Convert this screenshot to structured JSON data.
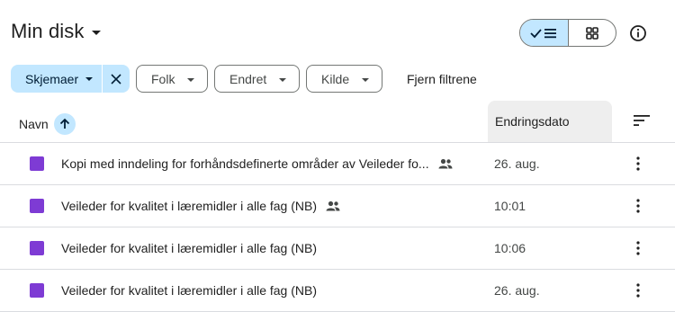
{
  "header": {
    "title": "Min disk"
  },
  "view_toggle": {
    "list_icon": "check-list-icon",
    "grid_icon": "grid-icon"
  },
  "filters": [
    {
      "label": "Skjemaer",
      "active": true
    },
    {
      "label": "Folk"
    },
    {
      "label": "Endret"
    },
    {
      "label": "Kilde"
    }
  ],
  "clear_filters_label": "Fjern filtrene",
  "columns": {
    "name": "Navn",
    "modified": "Endringsdato"
  },
  "files": [
    {
      "name": "Kopi med inndeling for forhåndsdefinerte områder av Veileder fo...",
      "date": "26. aug.",
      "shared": true
    },
    {
      "name": "Veileder for kvalitet i læremidler i alle fag (NB)",
      "date": "10:01",
      "shared": true
    },
    {
      "name": "Veileder for kvalitet i læremidler i alle fag (NB)",
      "date": "10:06",
      "shared": false
    },
    {
      "name": "Veileder for kvalitet i læremidler i alle fag (NB)",
      "date": "26. aug.",
      "shared": false
    }
  ],
  "colors": {
    "accent": "#c2e7ff",
    "forms_purple": "#7e3bd4",
    "header_bg": "#eeeeee"
  }
}
